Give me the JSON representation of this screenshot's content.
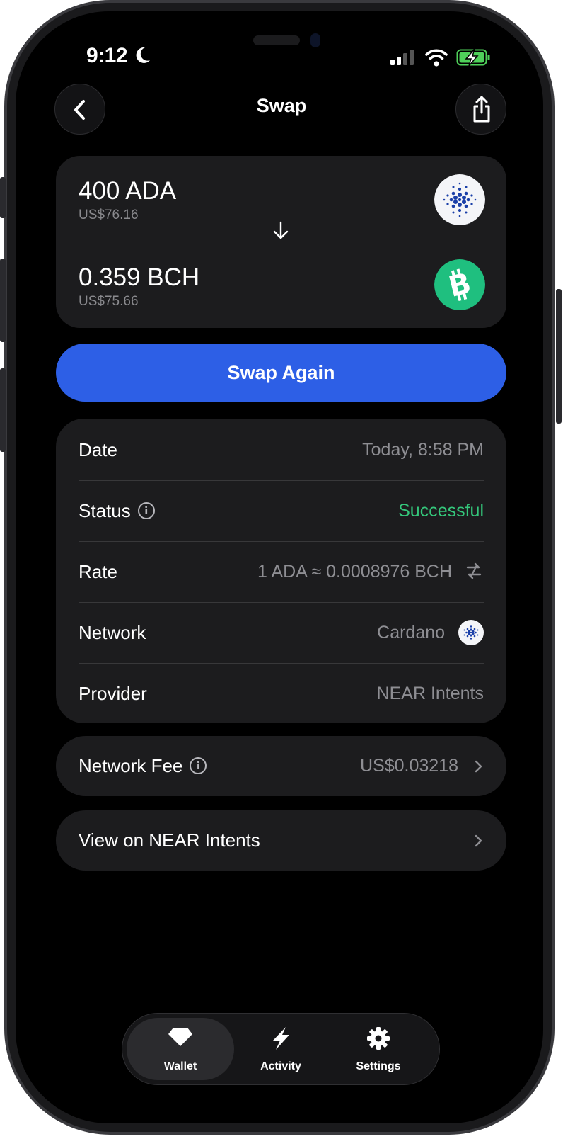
{
  "status_bar": {
    "time": "9:12"
  },
  "header": {
    "title": "Swap"
  },
  "swap": {
    "from_amount": "400 ADA",
    "from_usd": "US$76.16",
    "to_amount": "0.359 BCH",
    "to_usd": "US$75.66"
  },
  "swap_again_label": "Swap Again",
  "details": {
    "date_label": "Date",
    "date_value": "Today, 8:58 PM",
    "status_label": "Status",
    "status_value": "Successful",
    "rate_label": "Rate",
    "rate_value": "1 ADA ≈ 0.0008976 BCH",
    "network_label": "Network",
    "network_value": "Cardano",
    "provider_label": "Provider",
    "provider_value": "NEAR Intents"
  },
  "fee": {
    "label": "Network Fee",
    "value": "US$0.03218"
  },
  "view_link": {
    "label": "View on NEAR Intents"
  },
  "tabs": [
    {
      "label": "Wallet",
      "icon": "diamond-icon",
      "active": true
    },
    {
      "label": "Activity",
      "icon": "bolt-icon",
      "active": false
    },
    {
      "label": "Settings",
      "icon": "gear-icon",
      "active": false
    }
  ],
  "colors": {
    "accent": "#2d5fe6",
    "success": "#34c77b",
    "bch": "#1fbf7f",
    "ada": "#1a3fa8"
  }
}
